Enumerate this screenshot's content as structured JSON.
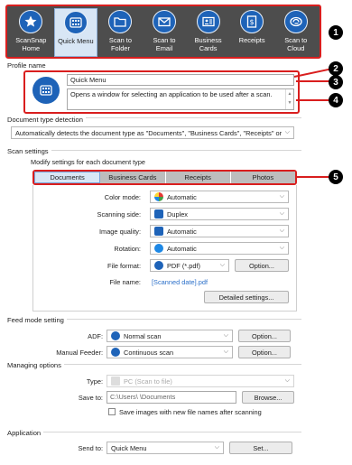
{
  "toolbar": {
    "items": [
      {
        "label": "ScanSnap\nHome",
        "icon": "star-icon"
      },
      {
        "label": "Quick Menu",
        "icon": "grid-icon"
      },
      {
        "label": "Scan to\nFolder",
        "icon": "folder-icon"
      },
      {
        "label": "Scan to\nEmail",
        "icon": "envelope-icon"
      },
      {
        "label": "Business\nCards",
        "icon": "card-icon"
      },
      {
        "label": "Receipts",
        "icon": "receipt-icon"
      },
      {
        "label": "Scan to\nCloud",
        "icon": "cloud-icon"
      }
    ],
    "active_index": 1
  },
  "callouts": [
    "1",
    "2",
    "3",
    "4",
    "5"
  ],
  "profile": {
    "section_label": "Profile name",
    "name_value": "Quick Menu",
    "description": "Opens a window for selecting an application to be used after a scan."
  },
  "doc_type": {
    "section_label": "Document type detection",
    "value": "Automatically detects the document type as \"Documents\", \"Business Cards\", \"Receipts\" or \"Photos\""
  },
  "scan_settings": {
    "section_label": "Scan settings",
    "sub_label": "Modify settings for each document type",
    "tabs": [
      "Documents",
      "Business Cards",
      "Receipts",
      "Photos"
    ],
    "active_tab": 0,
    "color_mode": {
      "label": "Color mode:",
      "value": "Automatic"
    },
    "scanning_side": {
      "label": "Scanning side:",
      "value": "Duplex"
    },
    "image_quality": {
      "label": "Image quality:",
      "value": "Automatic"
    },
    "rotation": {
      "label": "Rotation:",
      "value": "Automatic"
    },
    "file_format": {
      "label": "File format:",
      "value": "PDF (*.pdf)",
      "button": "Option..."
    },
    "file_name": {
      "label": "File name:",
      "value": "[Scanned date].pdf"
    },
    "detailed_button": "Detailed settings..."
  },
  "feed_mode": {
    "section_label": "Feed mode setting",
    "adf": {
      "label": "ADF:",
      "value": "Normal scan",
      "button": "Option..."
    },
    "manual": {
      "label": "Manual Feeder:",
      "value": "Continuous scan",
      "button": "Option..."
    }
  },
  "managing": {
    "section_label": "Managing options",
    "type": {
      "label": "Type:",
      "value": "PC (Scan to file)"
    },
    "save_to": {
      "label": "Save to:",
      "value": "C:\\Users\\        \\Documents",
      "button": "Browse..."
    },
    "checkbox_label": "Save images with new file names after scanning"
  },
  "application": {
    "section_label": "Application",
    "send_to": {
      "label": "Send to:",
      "value": "Quick Menu",
      "button": "Set..."
    }
  }
}
